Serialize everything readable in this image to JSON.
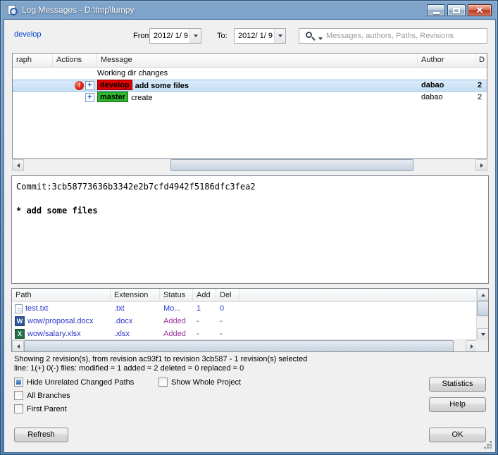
{
  "window": {
    "title": "Log Messages - D:\\tmp\\lumpy"
  },
  "toolbar": {
    "branch_link": "develop",
    "from_label": "From:",
    "from_value": "2012/ 1/ 9",
    "to_label": "To:",
    "to_value": "2012/ 1/ 9",
    "search_placeholder": "Messages, authors, Paths, Revisions"
  },
  "icons": {
    "search-icon": "magnifier-glass",
    "dropdown-arrow-icon": "down-triangle",
    "modified-icon": "!",
    "added-icon": "+",
    "word-file-icon": "W",
    "excel-file-icon": "X"
  },
  "log_table": {
    "columns": {
      "graph": "raph",
      "actions": "Actions",
      "message": "Message",
      "author": "Author",
      "date": "D"
    },
    "rows": [
      {
        "message": "Working dir changes",
        "author": "",
        "date": ""
      },
      {
        "branch_badge": "develop",
        "badge_color": "#e00000",
        "message": "add some files",
        "author": "dabao",
        "date": "2",
        "selected": true
      },
      {
        "branch_badge": "master",
        "badge_color": "#2eb82e",
        "message": "create",
        "author": "dabao",
        "date": "2",
        "selected": false
      }
    ]
  },
  "commit_message": {
    "line1": "Commit:3cb58773636b3342e2b7cfd4942f5186dfc3fea2",
    "line2": "* add some files"
  },
  "file_table": {
    "columns": {
      "path": "Path",
      "extension": "Extension",
      "status": "Status",
      "add": "Add",
      "del": "Del"
    },
    "rows": [
      {
        "path": "test.txt",
        "extension": ".txt",
        "status": "Mo...",
        "add": "1",
        "del": "0",
        "row_color": "#2a35c8",
        "status_color": "#2a35c8"
      },
      {
        "path": "wow/proposal.docx",
        "extension": ".docx",
        "status": "Added",
        "add": "-",
        "del": "-",
        "row_color": "#2a35c8",
        "status_color": "#9a33a0"
      },
      {
        "path": "wow/salary.xlsx",
        "extension": ".xlsx",
        "status": "Added",
        "add": "-",
        "del": "-",
        "row_color": "#2a35c8",
        "status_color": "#9a33a0"
      }
    ]
  },
  "status": {
    "line1": "Showing 2 revision(s), from revision ac93f1 to revision 3cb587 - 1 revision(s) selected",
    "line2": "line: 1(+) 0(-) files: modified = 1 added = 2 deleted = 0 replaced = 0"
  },
  "checkboxes": [
    {
      "label": "Hide Unrelated Changed Paths",
      "checked": true
    },
    {
      "label": "Show Whole Project",
      "checked": false
    },
    {
      "label": "All Branches",
      "checked": false
    },
    {
      "label": "First Parent",
      "checked": false
    }
  ],
  "buttons": {
    "statistics": "Statistics",
    "help": "Help",
    "ok": "OK",
    "refresh": "Refresh"
  },
  "colors": {
    "selected_row": "#cde7fb",
    "link": "#0046cf",
    "modified_text": "#2a35c8",
    "added_text": "#9a33a0"
  }
}
